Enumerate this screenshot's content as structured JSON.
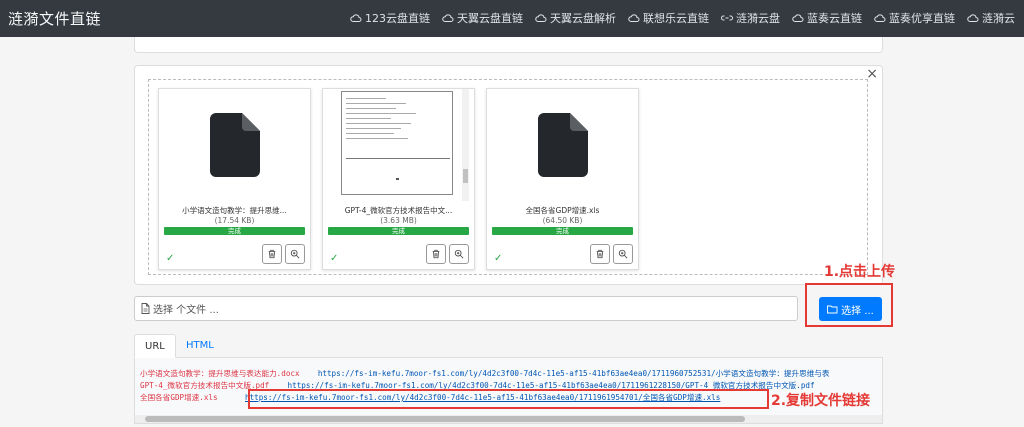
{
  "navbar": {
    "brand": "涟漪文件直链",
    "links": [
      {
        "label": "123云盘直链",
        "icon": "cloud-icon"
      },
      {
        "label": "天翼云盘直链",
        "icon": "cloud-icon"
      },
      {
        "label": "天翼云盘解析",
        "icon": "cloud-icon"
      },
      {
        "label": "联想乐云直链",
        "icon": "cloud-icon"
      },
      {
        "label": "涟漪云盘",
        "icon": "link-icon"
      },
      {
        "label": "蓝奏云直链",
        "icon": "cloud-icon"
      },
      {
        "label": "蓝奏优享直链",
        "icon": "cloud-icon"
      },
      {
        "label": "涟漪云",
        "icon": "cloud-icon"
      }
    ]
  },
  "upload": {
    "close": "×",
    "files": [
      {
        "name": "小学语文造句教学：提升思维...",
        "size": "(17.54 KB)",
        "status": "完成",
        "preview": "file-icon"
      },
      {
        "name": "GPT-4_微软官方技术报告中文...",
        "size": "(3.63 MB)",
        "status": "完成",
        "preview": "document-preview"
      },
      {
        "name": "全国各省GDP增速.xls",
        "size": "(64.50 KB)",
        "status": "完成",
        "preview": "file-icon"
      }
    ],
    "input_placeholder": "选择 个文件 ...",
    "choose_label": "选择 ..."
  },
  "annotations": {
    "step1": "1.点击上传",
    "step2": "2.复制文件链接",
    "color": "#e53935"
  },
  "tabs": [
    {
      "label": "URL",
      "active": true
    },
    {
      "label": "HTML",
      "active": false
    }
  ],
  "links": [
    {
      "name": "小学语文造句教学：提升思维与表达能力.docx",
      "url": "https://fs-im-kefu.7moor-fs1.com/ly/4d2c3f00-7d4c-11e5-af15-41bf63ae4ea0/1711960752531/小学语文造句教学：提升思维与表"
    },
    {
      "name": "GPT-4_微软官方技术报告中文版.pdf",
      "url": "https://fs-im-kefu.7moor-fs1.com/ly/4d2c3f00-7d4c-11e5-af15-41bf63ae4ea0/1711961228150/GPT-4_微软官方技术报告中文版.pdf"
    },
    {
      "name": "全国各省GDP增速.xls",
      "url": "https://fs-im-kefu.7moor-fs1.com/ly/4d2c3f00-7d4c-11e5-af15-41bf63ae4ea0/1711961954701/全国各省GDP增速.xls"
    }
  ],
  "colors": {
    "navbar": "#343a40",
    "primary": "#007bff",
    "success": "#28a745",
    "file_name": "#dc3545"
  }
}
